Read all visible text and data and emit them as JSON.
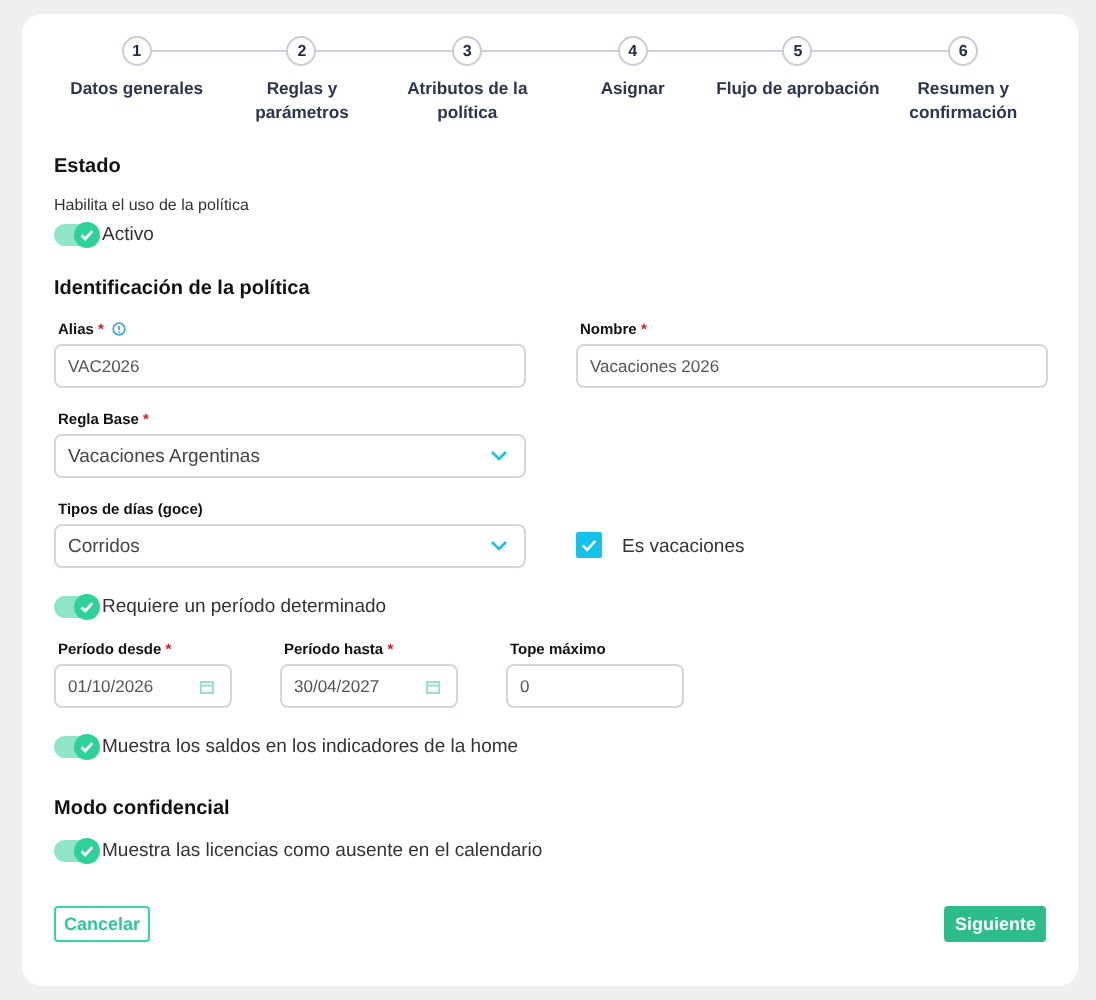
{
  "stepper": [
    {
      "number": "1",
      "label": "Datos generales"
    },
    {
      "number": "2",
      "label": "Reglas y parámetros"
    },
    {
      "number": "3",
      "label": "Atributos de la política"
    },
    {
      "number": "4",
      "label": "Asignar"
    },
    {
      "number": "5",
      "label": "Flujo de aprobación"
    },
    {
      "number": "6",
      "label": "Resumen y confirmación"
    }
  ],
  "estado": {
    "heading": "Estado",
    "description": "Habilita el uso de la política",
    "toggle": {
      "label": "Activo",
      "on": true
    }
  },
  "identificacion": {
    "heading": "Identificación de la política",
    "alias": {
      "label": "Alias",
      "required_mark": "*",
      "help": true,
      "kind": "text",
      "value": "VAC2026"
    },
    "nombre": {
      "label": "Nombre",
      "required_mark": "*",
      "help": false,
      "kind": "text",
      "value": "Vacaciones 2026"
    },
    "regla_base": {
      "label": "Regla Base",
      "required_mark": "*",
      "help": false,
      "kind": "select",
      "value": "Vacaciones Argentinas"
    },
    "tipos_dias": {
      "label": "Tipos de días (goce)",
      "help": false,
      "kind": "select",
      "value": "Corridos"
    },
    "es_vacaciones": {
      "label": "Es vacaciones",
      "checked": true
    },
    "periodo_toggle": {
      "label": "Requiere un período determinado",
      "on": true
    },
    "period_fields": [
      {
        "label": "Período desde",
        "required_mark": "*",
        "help": false,
        "kind": "date",
        "value": "01/10/2026"
      },
      {
        "label": "Período hasta",
        "required_mark": "*",
        "help": false,
        "kind": "date",
        "value": "30/04/2027"
      },
      {
        "label": "Tope máximo",
        "help": false,
        "kind": "text",
        "value": "0"
      }
    ],
    "home_toggle": {
      "label": "Muestra los saldos en los indicadores de la home",
      "on": true
    }
  },
  "confidencial": {
    "heading": "Modo confidencial",
    "toggle": {
      "label": "Muestra las licencias como ausente en el calendario",
      "on": true
    }
  },
  "buttons": {
    "cancel": "Cancelar",
    "next": "Siguiente"
  }
}
